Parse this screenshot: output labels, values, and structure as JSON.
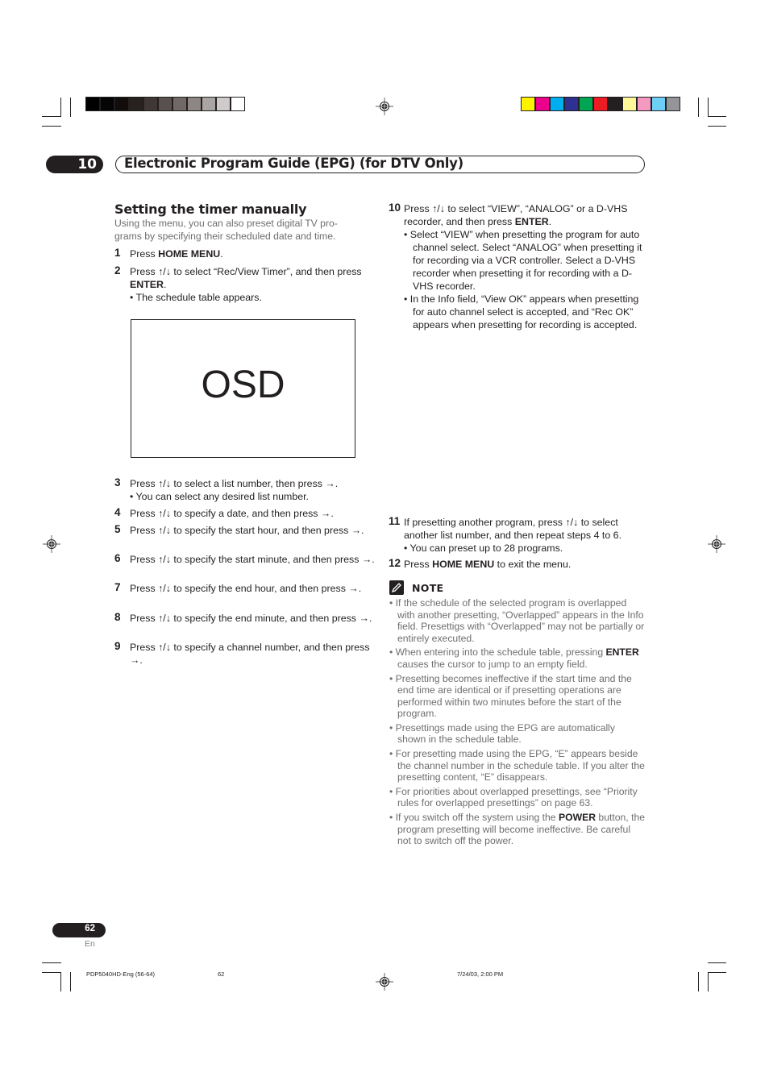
{
  "colors": {
    "gray_bar": [
      "#000000",
      "#050505",
      "#120d0a",
      "#272220",
      "#3f3836",
      "#585150",
      "#716967",
      "#8d8685",
      "#aaa5a4",
      "#cfcbca",
      "#ffffff"
    ],
    "color_bar": [
      "#fff200",
      "#ec008c",
      "#00aeef",
      "#2e3192",
      "#00a651",
      "#ed1c24",
      "#231f20",
      "#fff799",
      "#f49ac1",
      "#6dcff6",
      "#939598"
    ],
    "text": "#231f20",
    "muted_text": "#6d6e70"
  },
  "header": {
    "chapter_number": "10",
    "chapter_title": "Electronic Program Guide (EPG) (for DTV Only)"
  },
  "section": {
    "title": "Setting the timer manually",
    "intro": "Using the menu, you can also preset digital TV pro-grams by specifying their scheduled date and time."
  },
  "steps_left": [
    {
      "n": "1",
      "pre": "Press ",
      "bold": "HOME MENU",
      "post": "."
    },
    {
      "n": "2",
      "pre": "Press ↑/↓ to select “Rec/View Timer”, and then press ",
      "bold": "ENTER",
      "post": ".",
      "sub": "• The schedule table appears."
    }
  ],
  "osd": {
    "label": "OSD"
  },
  "steps_left_lower": [
    {
      "n": "3",
      "text": "Press ↑/↓ to select a list number, then press →.",
      "sub": "• You can select any desired list number."
    },
    {
      "n": "4",
      "text": "Press ↑/↓ to specify a date, and then press →."
    },
    {
      "n": "5",
      "text": "Press ↑/↓ to specify the start hour, and then press →."
    },
    {
      "n": "6",
      "text": "Press ↑/↓ to specify the start minute, and then press →."
    },
    {
      "n": "7",
      "text": "Press ↑/↓ to specify the end hour, and then press →."
    },
    {
      "n": "8",
      "text": "Press ↑/↓ to specify the end minute, and then press →."
    },
    {
      "n": "9",
      "text": "Press ↑/↓ to specify a channel number, and then press →."
    }
  ],
  "steps_right": [
    {
      "n": "10",
      "pre": "Press ↑/↓ to select “VIEW”, “ANALOG” or a D-VHS recorder, and then press ",
      "bold": "ENTER",
      "post": ".",
      "subs": [
        "• Select “VIEW” when presetting the program for auto channel select. Select “ANALOG” when presetting it for recording via a VCR controller. Select a D-VHS recorder when presetting it for recording with a D-VHS recorder.",
        "• In the Info field, “View OK” appears when presetting for auto channel select is accepted, and “Rec OK” appears when presetting for recording is accepted."
      ]
    },
    {
      "n": "11",
      "pre": "If presetting another program, press ↑/↓ to select another list number, and then repeat steps 4 to 6.",
      "subs": [
        "• You can preset up to 28 programs."
      ]
    },
    {
      "n": "12",
      "pre": "Press ",
      "bold": "HOME MENU",
      "post": " to exit the menu."
    }
  ],
  "note": {
    "icon": "pencil-note-icon",
    "label": "NOTE",
    "items": [
      {
        "pre": "If the schedule of the selected program is overlapped with another presetting, “Overlapped” appears in the Info field. Presettigs with “Overlapped” may not be partially or entirely executed."
      },
      {
        "pre": "When entering into the schedule table, pressing ",
        "bold": "ENTER",
        "post": " causes the cursor to jump to an empty field."
      },
      {
        "pre": "Presetting becomes ineffective if the start time and the end time are identical or if presetting operations are performed within two minutes before the start of the program."
      },
      {
        "pre": "Presettings made using the EPG are automatically shown in the schedule table."
      },
      {
        "pre": "For presetting made using the EPG, “E” appears beside the channel number in the schedule table. If you alter the presetting content, “E” disappears."
      },
      {
        "pre": "For priorities about overlapped presettings, see “Priority rules for overlapped presettings” on page 63."
      },
      {
        "pre": "If you switch off the system using the ",
        "bold": "POWER",
        "post": " button, the program presetting will become ineffective. Be careful not to switch off the power."
      }
    ]
  },
  "footer": {
    "page_number": "62",
    "language": "En",
    "slug_file": "PDP5040HD-Eng (56-64)",
    "slug_page": "62",
    "slug_date": "7/24/03, 2:00 PM"
  }
}
